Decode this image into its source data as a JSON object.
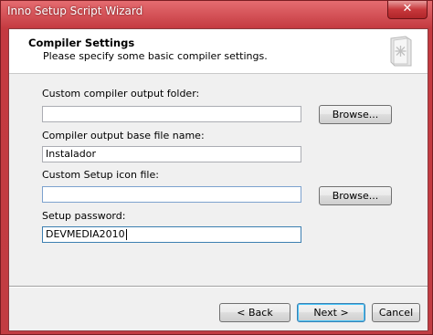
{
  "window": {
    "title": "Inno Setup Script Wizard",
    "close_glyph": "✕"
  },
  "header": {
    "title": "Compiler Settings",
    "subtitle": "Please specify some basic compiler settings.",
    "icon": "wizard-page-icon"
  },
  "fields": {
    "output_folder": {
      "label": "Custom compiler output folder:",
      "value": ""
    },
    "base_file_name": {
      "label": "Compiler output base file name:",
      "value": "Instalador"
    },
    "icon_file": {
      "label": "Custom Setup icon file:",
      "value": ""
    },
    "password": {
      "label": "Setup password:",
      "value": "DEVMEDIA2010"
    }
  },
  "buttons": {
    "browse_output": "Browse...",
    "browse_icon": "Browse...",
    "back": "< Back",
    "next": "Next >",
    "cancel": "Cancel"
  }
}
